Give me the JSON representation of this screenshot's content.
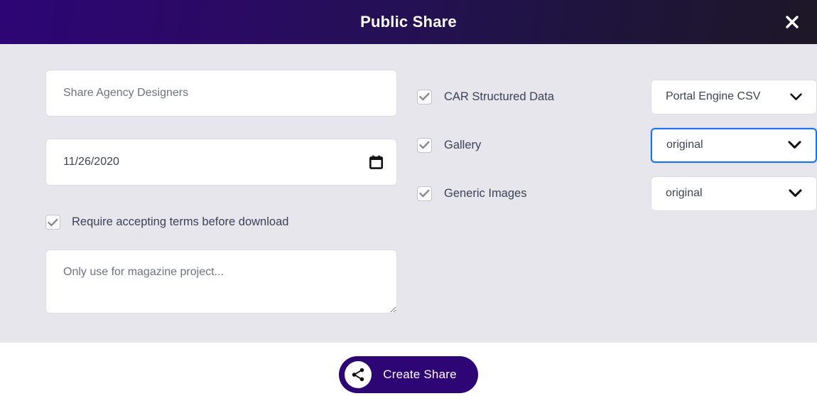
{
  "dialog": {
    "title": "Public Share",
    "close_icon": "close-icon"
  },
  "colors": {
    "header_gradient_start": "#2d0575",
    "header_gradient_end": "#1d1726",
    "body_background": "#e6e6ec",
    "accent_purple": "#2d0575",
    "focus_blue": "#1a73e8",
    "text": "#3c4257",
    "placeholder": "#6b7280"
  },
  "left_column": {
    "share_name": {
      "value": "",
      "placeholder": "Share Agency Designers"
    },
    "expiry_date": {
      "value": "11/26/2020",
      "icon": "calendar-icon"
    },
    "require_terms": {
      "label": "Require accepting terms before download",
      "checked": true
    },
    "note": {
      "value": "",
      "placeholder": "Only use for magazine project..."
    }
  },
  "right_column": {
    "options": [
      {
        "label": "CAR Structured Data",
        "checked": true,
        "select_value": "Portal Engine CSV",
        "focused": false
      },
      {
        "label": "Gallery",
        "checked": true,
        "select_value": "original",
        "focused": true
      },
      {
        "label": "Generic Images",
        "checked": true,
        "select_value": "original",
        "focused": false
      }
    ]
  },
  "footer": {
    "submit_label": "Create Share",
    "submit_icon": "share-icon"
  }
}
